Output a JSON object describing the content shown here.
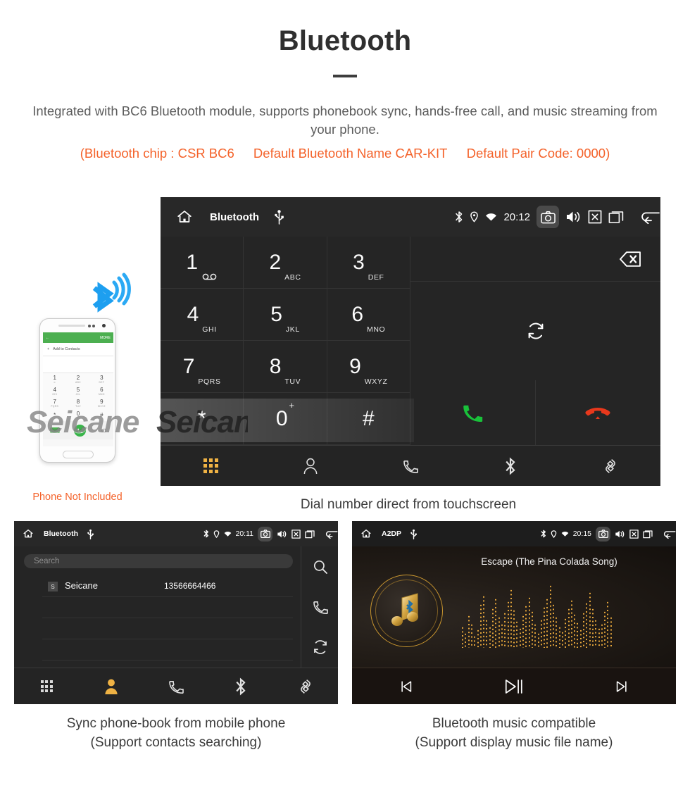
{
  "header": {
    "title": "Bluetooth",
    "intro": "Integrated with BC6 Bluetooth module, supports phonebook sync, hands-free call, and music streaming from your phone.",
    "spec_chip": "(Bluetooth chip : CSR BC6",
    "spec_name": "Default Bluetooth Name CAR-KIT",
    "spec_pair": "Default Pair Code: 0000)"
  },
  "colors": {
    "accent_orange": "#f4622a",
    "panel_bg": "#252525",
    "statusbar_bg": "#282828",
    "active_nav": "#efb244",
    "call_green": "#19c13a",
    "end_red": "#e8381c",
    "gold": "#c9962f",
    "phone_green": "#4caf50"
  },
  "dialer": {
    "statusbar": {
      "home_icon": "home-icon",
      "title": "Bluetooth",
      "usb_icon": "usb-icon",
      "bt_icon": "bluetooth-icon",
      "location_icon": "location-icon",
      "wifi_icon": "wifi-icon",
      "clock": "20:12",
      "camera_icon": "camera-icon",
      "volume_icon": "volume-icon",
      "close_icon": "close-box-icon",
      "recents_icon": "recents-icon",
      "back_icon": "back-icon"
    },
    "keys": [
      {
        "num": "1",
        "sub": "",
        "icon": "voicemail-icon"
      },
      {
        "num": "2",
        "sub": "ABC",
        "icon": ""
      },
      {
        "num": "3",
        "sub": "DEF",
        "icon": ""
      },
      {
        "num": "4",
        "sub": "GHI",
        "icon": ""
      },
      {
        "num": "5",
        "sub": "JKL",
        "icon": ""
      },
      {
        "num": "6",
        "sub": "MNO",
        "icon": ""
      },
      {
        "num": "7",
        "sub": "PQRS",
        "icon": ""
      },
      {
        "num": "8",
        "sub": "TUV",
        "icon": ""
      },
      {
        "num": "9",
        "sub": "WXYZ",
        "icon": ""
      },
      {
        "num": "*",
        "sub": "",
        "icon": ""
      },
      {
        "num": "0",
        "sub": "",
        "icon": "plus-superscript"
      },
      {
        "num": "#",
        "sub": "",
        "icon": ""
      }
    ],
    "number_input_value": "",
    "delete_icon": "backspace-icon",
    "sync_icon": "sync-icon",
    "call_icon": "call-icon",
    "end_call_icon": "end-call-icon",
    "nav": [
      {
        "icon": "keypad-icon",
        "label": "Keypad",
        "active": true
      },
      {
        "icon": "contacts-icon",
        "label": "Contacts",
        "active": false
      },
      {
        "icon": "call-log-icon",
        "label": "Call log",
        "active": false
      },
      {
        "icon": "bluetooth-icon",
        "label": "Bluetooth",
        "active": false
      },
      {
        "icon": "pair-link-icon",
        "label": "Pair",
        "active": false
      }
    ],
    "caption": "Dial number direct from touchscreen"
  },
  "phone_mockup": {
    "green_bar_back_icon": "back-arrow-icon",
    "green_bar_more": "MORE",
    "add_to_contacts": "Add to Contacts",
    "keys": [
      {
        "num": "1",
        "sub": "∞"
      },
      {
        "num": "2",
        "sub": "ABC"
      },
      {
        "num": "3",
        "sub": "DEF"
      },
      {
        "num": "4",
        "sub": "GHI"
      },
      {
        "num": "5",
        "sub": "JKL"
      },
      {
        "num": "6",
        "sub": "MNO"
      },
      {
        "num": "7",
        "sub": "PQRS"
      },
      {
        "num": "8",
        "sub": "TUV"
      },
      {
        "num": "9",
        "sub": "WXYZ"
      },
      {
        "num": "*",
        "sub": ""
      },
      {
        "num": "0",
        "sub": "+"
      },
      {
        "num": "#",
        "sub": ""
      }
    ],
    "signal_icon": "bluetooth-signal-icon",
    "disclaimer": "Phone Not Included"
  },
  "watermark": {
    "text": "Seicane"
  },
  "phonebook": {
    "statusbar": {
      "title": "Bluetooth",
      "clock": "20:11"
    },
    "search_placeholder": "Search",
    "contacts": [
      {
        "initial": "S",
        "name": "Seicane",
        "number": "13566664466"
      }
    ],
    "empty_rows": 3,
    "rail": [
      {
        "icon": "search-icon",
        "label": "Search"
      },
      {
        "icon": "call-icon",
        "label": "Call"
      },
      {
        "icon": "sync-icon",
        "label": "Sync"
      }
    ],
    "nav": [
      {
        "icon": "keypad-icon",
        "active": false
      },
      {
        "icon": "contacts-icon",
        "active": true
      },
      {
        "icon": "call-log-icon",
        "active": false
      },
      {
        "icon": "bluetooth-icon",
        "active": false
      },
      {
        "icon": "pair-link-icon",
        "active": false
      }
    ],
    "caption_line1": "Sync phone-book from mobile phone",
    "caption_line2": "(Support contacts searching)"
  },
  "music": {
    "statusbar": {
      "title": "A2DP",
      "clock": "20:15"
    },
    "song_title": "Escape (The Pina Colada Song)",
    "album_icon": "bluetooth-music-note-icon",
    "visualizer_levels": [
      30,
      22,
      46,
      34,
      18,
      26,
      62,
      74,
      40,
      30,
      56,
      70,
      44,
      34,
      50,
      66,
      82,
      54,
      38,
      28,
      46,
      60,
      72,
      52,
      34,
      22,
      40,
      58,
      70,
      88,
      62,
      44,
      30,
      24,
      42,
      56,
      68,
      48,
      36,
      26,
      50,
      64,
      78,
      56,
      40,
      28,
      34,
      52,
      66,
      44
    ],
    "controls": [
      {
        "icon": "previous-track-icon",
        "label": "Previous"
      },
      {
        "icon": "play-pause-icon",
        "label": "Play/Pause"
      },
      {
        "icon": "next-track-icon",
        "label": "Next"
      }
    ],
    "caption_line1": "Bluetooth music compatible",
    "caption_line2": "(Support display music file name)"
  }
}
